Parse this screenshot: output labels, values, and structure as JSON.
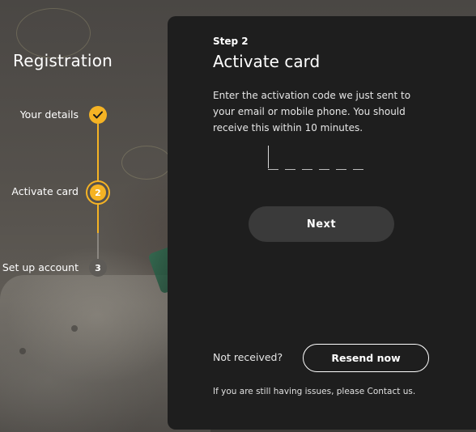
{
  "registration": {
    "title": "Registration",
    "steps": [
      {
        "label": "Your details",
        "state": "done",
        "icon": "check-icon"
      },
      {
        "label": "Activate card",
        "state": "current",
        "number": "2"
      },
      {
        "label": "Set up account",
        "state": "todo",
        "number": "3"
      }
    ]
  },
  "panel": {
    "step_kicker": "Step 2",
    "title": "Activate card",
    "instructions": "Enter the activation code we just sent to your email or mobile phone. You should receive this within 10 minutes.",
    "code_input": {
      "value": "",
      "slots": 6
    },
    "next_label": "Next",
    "not_received_label": "Not received?",
    "resend_label": "Resend now",
    "help_prefix": "If you are still having issues, please ",
    "help_link": "Contact us",
    "help_suffix": "."
  },
  "colors": {
    "accent": "#f5b324",
    "panel_bg": "#1e1e1e",
    "pending_circle": "#5e5b57"
  }
}
